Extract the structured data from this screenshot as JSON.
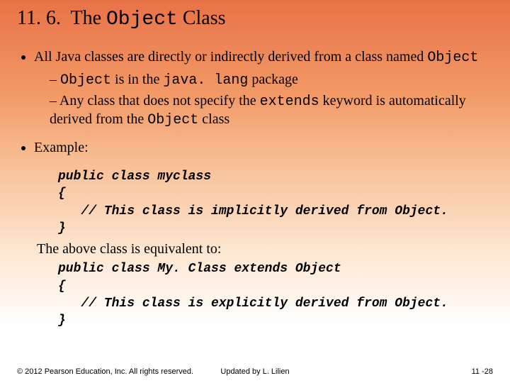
{
  "title": {
    "section": "11. 6.",
    "pre": "The ",
    "code": "Object",
    "post": " Class"
  },
  "bullet1": {
    "seg1": "All Java classes are directly or indirectly derived from a class named ",
    "code1": "Object",
    "sub1_code1": "Object",
    "sub1_seg1": " is in the ",
    "sub1_code2": "java. lang",
    "sub1_seg2": " package",
    "sub2_seg1": "Any class that does not specify the ",
    "sub2_code1": "extends",
    "sub2_seg2": " keyword is automatically derived from the ",
    "sub2_code2": "Object",
    "sub2_seg3": " class"
  },
  "bullet2": {
    "label": "Example:",
    "code1": "public class myclass\n{\n   // This class is implicitly derived from Object.\n}",
    "equiv": "The above class is equivalent to:",
    "code2": "public class My. Class extends Object\n{\n   // This class is explicitly derived from Object.\n}"
  },
  "footer": {
    "left": "© 2012 Pearson Education, Inc. All rights reserved.",
    "center": "Updated by L. Lilien",
    "right": "11 -28"
  }
}
